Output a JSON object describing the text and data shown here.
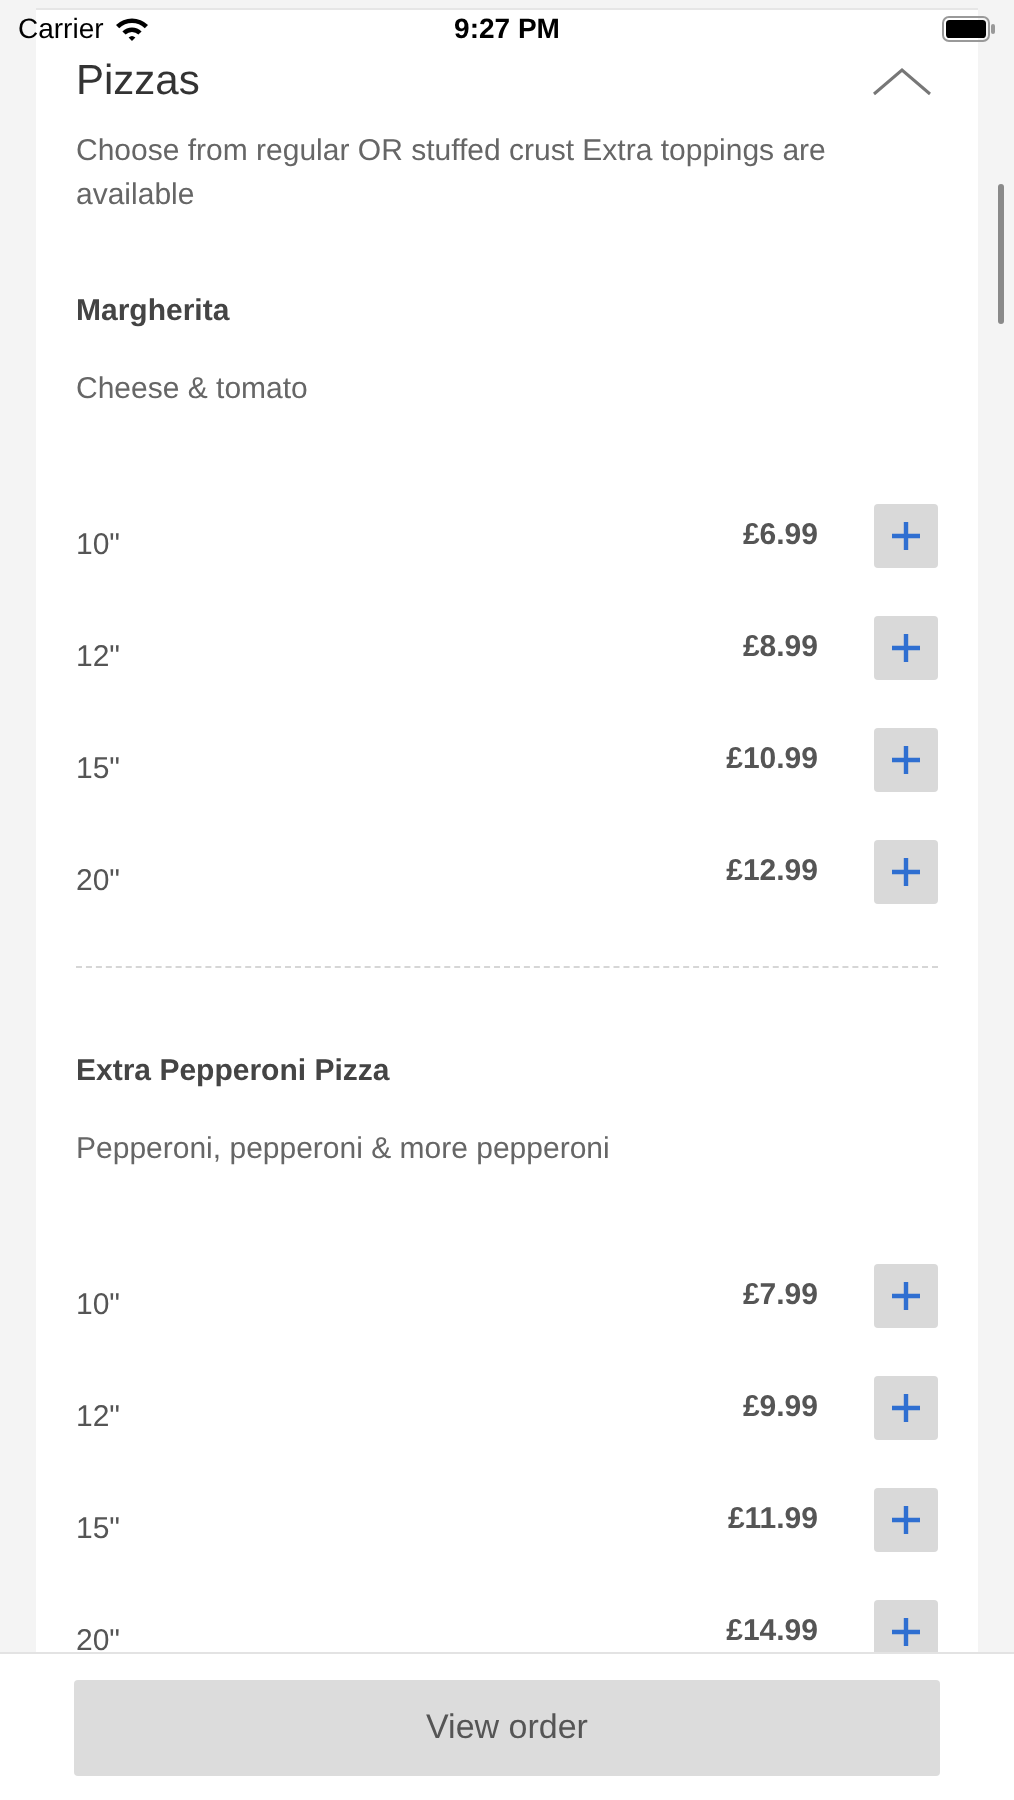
{
  "status_bar": {
    "carrier": "Carrier",
    "time": "9:27 PM"
  },
  "section": {
    "title": "Pizzas",
    "expanded": true,
    "description": "Choose from regular OR stuffed crust Extra toppings are available",
    "items": [
      {
        "name": "Margherita",
        "description": "Cheese & tomato",
        "sizes": [
          {
            "size": "10\"",
            "price": "£6.99"
          },
          {
            "size": "12\"",
            "price": "£8.99"
          },
          {
            "size": "15\"",
            "price": "£10.99"
          },
          {
            "size": "20\"",
            "price": "£12.99"
          }
        ]
      },
      {
        "name": "Extra Pepperoni Pizza",
        "description": "Pepperoni, pepperoni & more pepperoni",
        "sizes": [
          {
            "size": "10\"",
            "price": "£7.99"
          },
          {
            "size": "12\"",
            "price": "£9.99"
          },
          {
            "size": "15\"",
            "price": "£11.99"
          },
          {
            "size": "20\"",
            "price": "£14.99"
          }
        ]
      }
    ]
  },
  "footer": {
    "button": "View order"
  }
}
